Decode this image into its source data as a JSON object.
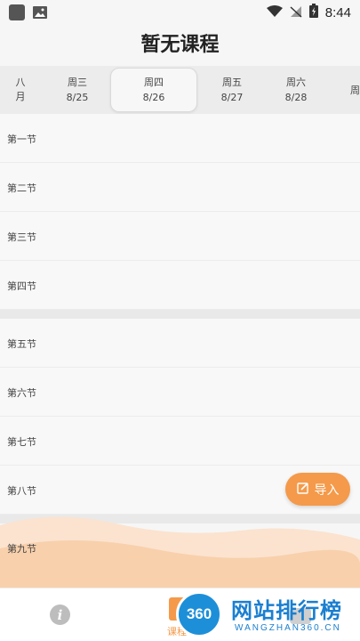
{
  "status_bar": {
    "time": "8:44"
  },
  "header": {
    "title": "暂无课程"
  },
  "week": {
    "month_line1": "八",
    "month_line2": "月",
    "days": [
      {
        "weekday": "周三",
        "date": "8/25"
      },
      {
        "weekday": "周四",
        "date": "8/26"
      },
      {
        "weekday": "周五",
        "date": "8/27"
      },
      {
        "weekday": "周六",
        "date": "8/28"
      },
      {
        "weekday": "周",
        "date": ""
      }
    ],
    "selected_index": 1
  },
  "periods": [
    "第一节",
    "第二节",
    "第三节",
    "第四节",
    "第五节",
    "第六节",
    "第七节",
    "第八节",
    "第九节"
  ],
  "import_button": {
    "label": "导入"
  },
  "bottom_nav": {
    "info_label": "i",
    "course_label": "课程"
  },
  "watermark": {
    "logo_text": "360",
    "title": "网站排行榜",
    "subtitle": "WANGZHAN360.CN"
  },
  "colors": {
    "accent": "#f49a4a",
    "watermark": "#1a7fd0"
  }
}
